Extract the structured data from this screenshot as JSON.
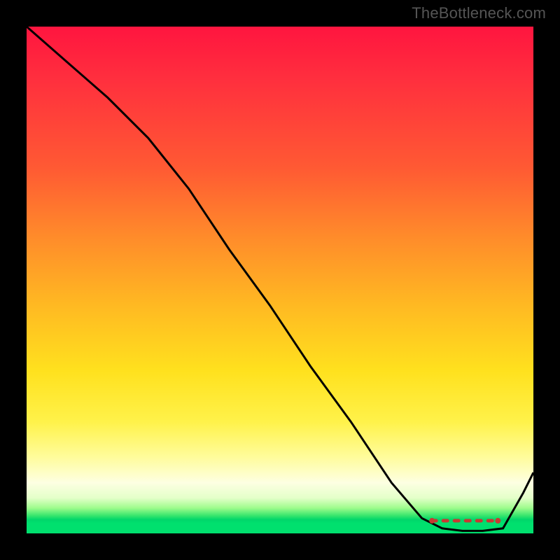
{
  "watermark": "TheBottleneck.com",
  "chart_data": {
    "type": "line",
    "title": "",
    "xlabel": "",
    "ylabel": "",
    "xlim": [
      0,
      100
    ],
    "ylim": [
      0,
      100
    ],
    "grid": false,
    "legend": false,
    "background_gradient": {
      "direction": "vertical",
      "stops": [
        {
          "pos": 0.0,
          "color": "#ff153f"
        },
        {
          "pos": 0.28,
          "color": "#ff5a33"
        },
        {
          "pos": 0.55,
          "color": "#ffb922"
        },
        {
          "pos": 0.78,
          "color": "#fff24a"
        },
        {
          "pos": 0.9,
          "color": "#fdffe2"
        },
        {
          "pos": 0.965,
          "color": "#37e56d"
        },
        {
          "pos": 1.0,
          "color": "#00e06e"
        }
      ]
    },
    "series": [
      {
        "name": "bottleneck-curve",
        "x": [
          0,
          8,
          16,
          24,
          32,
          40,
          48,
          56,
          64,
          72,
          78,
          82,
          86,
          90,
          94,
          98,
          100
        ],
        "y": [
          100,
          93,
          86,
          78,
          68,
          56,
          45,
          33,
          22,
          10,
          3,
          1,
          0.5,
          0.5,
          1,
          8,
          12
        ]
      }
    ],
    "annotations": [
      {
        "name": "optimal-flat-segment",
        "type": "dashed-segment",
        "y": 2.5,
        "x_start": 80,
        "x_end": 93,
        "color": "#c73a32"
      }
    ]
  }
}
